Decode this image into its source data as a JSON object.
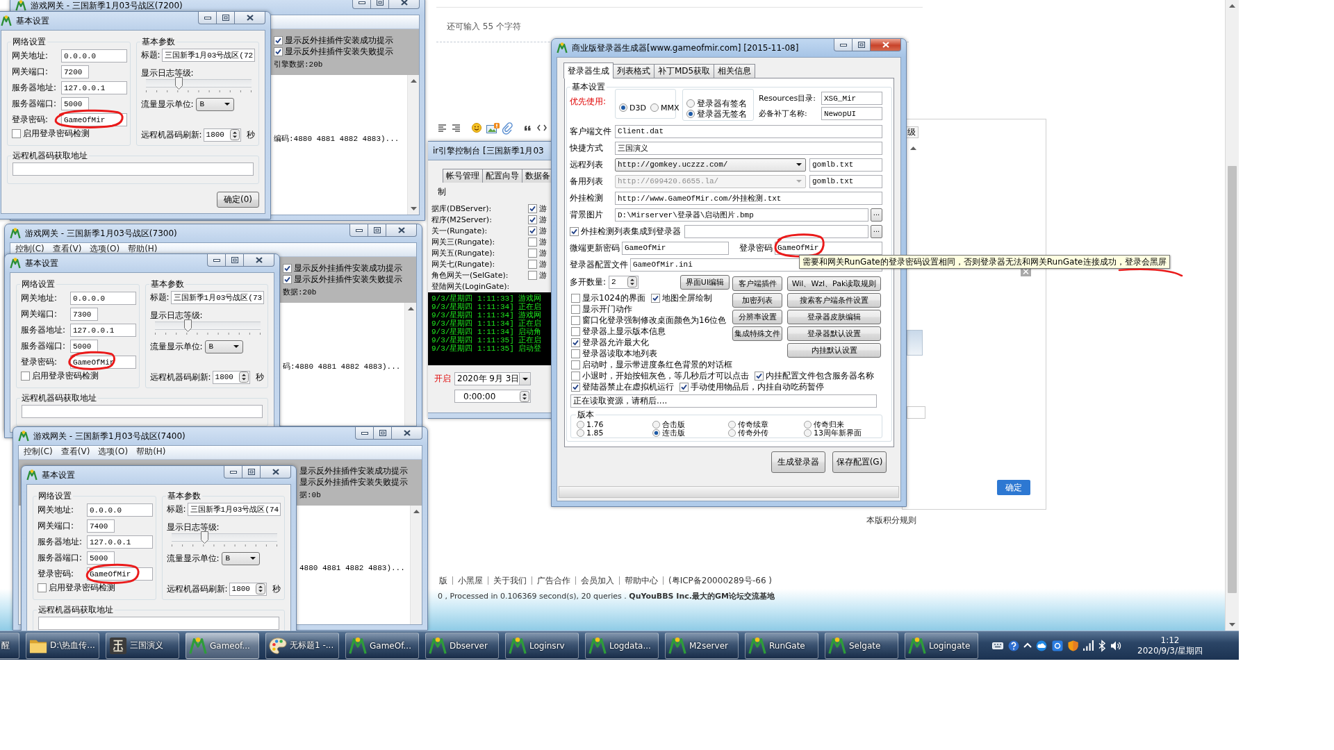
{
  "browser_page": {
    "char_hint": "还可输入 55 个字符",
    "side_panel": {
      "tab": "级",
      "ok_button": "确定"
    },
    "rules_link": "本版积分规则",
    "footer_links": [
      "版",
      "小黑屋",
      "关于我们",
      "广告合作",
      "会员加入",
      "帮助中心",
      "(粤ICP备20000289号-66 )"
    ],
    "footer_stats": "0 , Processed in 0.106369 second(s), 20 queries . **QuYouBBS Inc.最大的GM论坛交流基地**"
  },
  "console_window": {
    "title": "ir引擎控制台 [三国新季1月03",
    "tabs": [
      {
        "label": "帐号管理",
        "selected": false
      },
      {
        "label": "配置向导",
        "selected": false
      },
      {
        "label": "数据备",
        "selected": false
      }
    ],
    "group": "制",
    "services": [
      {
        "label": "据库(DBServer):",
        "checked": true,
        "option": "游"
      },
      {
        "label": "程序(M2Server):",
        "checked": true,
        "option": "游"
      },
      {
        "label": "关一(Rungate):",
        "checked": true,
        "option": "游"
      },
      {
        "label": "网关三(Rungate):",
        "checked": false,
        "option": "游"
      },
      {
        "label": "网关五(Rungate):",
        "checked": false,
        "option": "游"
      },
      {
        "label": "网关七(Rungate):",
        "checked": false,
        "option": "游"
      },
      {
        "label": "角色网关一(SelGate):",
        "checked": false,
        "option": "游"
      },
      {
        "label": "登陆网关(LoginGate):"
      }
    ],
    "log": [
      "9/3/星期四 1:11:33] 游戏网",
      "9/3/星期四 1:11:34] 正在启",
      "9/3/星期四 1:11:34] 游戏网",
      "9/3/星期四 1:11:34] 正在启",
      "9/3/星期四 1:11:34] 启动角",
      "9/3/星期四 1:11:35] 正在启",
      "9/3/星期四 1:11:35] 启动登"
    ],
    "schedule_label": "开启",
    "date": "2020年 9月 3日",
    "time": "0:00:00"
  },
  "gateway_windows": [
    {
      "title": "游戏网关 - 三国新季1月03号战区(7200)",
      "notices": [
        {
          "label": "显示反外挂插件安装成功提示",
          "checked": true
        },
        {
          "label": "显示反外挂插件安装失败提示",
          "checked": true
        }
      ],
      "data_label": "引擎数据:20b",
      "log_line": "编码:4880 4881 4882 4883)...",
      "dialog": {
        "title": "基本设置",
        "network_group": "网络设置",
        "fields": [
          {
            "label": "网关地址:",
            "value": "0.0.0.0",
            "kind": "wide"
          },
          {
            "label": "网关端口:",
            "value": "7200",
            "kind": "short"
          },
          {
            "label": "服务器地址:",
            "value": "127.0.0.1",
            "kind": "wide"
          },
          {
            "label": "服务器端口:",
            "value": "5000",
            "kind": "short"
          },
          {
            "label": "登录密码:",
            "value": "GameOfMir",
            "kind": "wide",
            "circled": true
          }
        ],
        "password_check": {
          "label": "启用登录密码检测",
          "checked": false
        },
        "params_group": "基本参数",
        "caption_label": "标题:",
        "caption": "三国新季1月03号战区(72",
        "log_level_label": "显示日志等级:",
        "log_level": {
          "level": 0.3
        },
        "unit_label": "流量显示单位:",
        "unit": "B",
        "refresh_label": "远程机器码刷新:",
        "refresh": "1800",
        "refresh_unit": "秒",
        "remote_group": "远程机器码获取地址",
        "ok_button": "确定(0)"
      }
    },
    {
      "title": "游戏网关 - 三国新季1月03号战区(7300)",
      "menu": [
        "控制(C)",
        "查看(V)",
        "选项(O)",
        "帮助(H)"
      ],
      "notices": [
        {
          "label": "显示反外挂插件安装成功提示",
          "checked": true
        },
        {
          "label": "显示反外挂插件安装失败提示",
          "checked": true
        }
      ],
      "data_label": "数据:20b",
      "log_line": "码:4880 4881 4882 4883)...",
      "dialog": {
        "title": "基本设置",
        "network_group": "网络设置",
        "fields": [
          {
            "label": "网关地址:",
            "value": "0.0.0.0",
            "kind": "wide"
          },
          {
            "label": "网关端口:",
            "value": "7300",
            "kind": "short"
          },
          {
            "label": "服务器地址:",
            "value": "127.0.0.1",
            "kind": "wide"
          },
          {
            "label": "服务器端口:",
            "value": "5000",
            "kind": "short"
          },
          {
            "label": "登录密码:",
            "value": "GameOfMir",
            "kind": "wide",
            "circled": true
          }
        ],
        "password_check": {
          "label": "启用登录密码检测",
          "checked": false
        },
        "params_group": "基本参数",
        "caption_label": "标题:",
        "caption": "三国新季1月03号战区(73",
        "log_level_label": "显示日志等级:",
        "log_level": {
          "level": 0.3
        },
        "unit_label": "流量显示单位:",
        "unit": "B",
        "refresh_label": "远程机器码刷新:",
        "refresh": "1800",
        "refresh_unit": "秒",
        "remote_group": "远程机器码获取地址"
      }
    },
    {
      "title": "游戏网关 - 三国新季1月03号战区(7400)",
      "menu": [
        "控制(C)",
        "查看(V)",
        "选项(O)",
        "帮助(H)"
      ],
      "notices": [
        {
          "label": "显示反外挂插件安装成功提示"
        },
        {
          "label": "显示反外挂插件安装失败提示"
        }
      ],
      "data_label": "据:0b",
      "log_line": "4880 4881 4882 4883)...",
      "dialog": {
        "title": "基本设置",
        "network_group": "网络设置",
        "fields": [
          {
            "label": "网关地址:",
            "value": "0.0.0.0",
            "kind": "wide"
          },
          {
            "label": "网关端口:",
            "value": "7400",
            "kind": "short"
          },
          {
            "label": "服务器地址:",
            "value": "127.0.0.1",
            "kind": "wide"
          },
          {
            "label": "服务器端口:",
            "value": "5000",
            "kind": "short"
          },
          {
            "label": "登录密码:",
            "value": "GameOfMir",
            "kind": "wide",
            "circled": true
          }
        ],
        "password_check": {
          "label": "启用登录密码检测",
          "checked": false
        },
        "params_group": "基本参数",
        "caption_label": "标题:",
        "caption": "三国新季1月03号战区(74",
        "log_level_label": "显示日志等级:",
        "log_level": {
          "level": 0.3
        },
        "unit_label": "流量显示单位:",
        "unit": "B",
        "refresh_label": "远程机器码刷新:",
        "refresh": "1800",
        "refresh_unit": "秒",
        "remote_group": "远程机器码获取地址"
      }
    }
  ],
  "generator_window": {
    "title": "商业版登录器生成器[www.gameofmir.com] [2015-11-08]",
    "tabs": [
      {
        "label": "登录器生成",
        "selected": true
      },
      {
        "label": "列表格式",
        "selected": false
      },
      {
        "label": "补丁MD5获取",
        "selected": false
      },
      {
        "label": "相关信息",
        "selected": false
      }
    ],
    "group": "基本设置",
    "priority_label": "优先使用:",
    "render_modes": [
      {
        "label": "D3D",
        "selected": true
      },
      {
        "label": "MMX",
        "selected": false
      }
    ],
    "signatures": [
      {
        "label": "登录器有签名",
        "selected": false
      },
      {
        "label": "登录器无签名",
        "selected": true
      }
    ],
    "resources_label": "Resources目录:",
    "resources": "XSG_Mir",
    "patch_label": "必备补丁名称:",
    "patch": "NewopUI",
    "rows": [
      {
        "kind": "text",
        "label": "客户端文件",
        "value": "Client.dat"
      },
      {
        "kind": "text",
        "label": "快捷方式",
        "value": "三国演义"
      },
      {
        "kind": "combo",
        "label": "远程列表",
        "value": "http://gomkey.uczzz.com/",
        "disabled": false,
        "file": "gomlb.txt"
      },
      {
        "kind": "combo",
        "label": "备用列表",
        "value": "http://699420.6655.la/",
        "disabled": true,
        "file": "gomlb.txt"
      },
      {
        "kind": "text",
        "label": "外挂检测",
        "value": "http://www.GameOfMir.com/外挂检测.txt"
      },
      {
        "kind": "browse",
        "label": "背景图片",
        "value": "D:\\Mirserver\\登录器\\启动图片.bmp",
        "button": "..."
      },
      {
        "kind": "check",
        "label": "外挂检测列表集成到登录器",
        "checked": true,
        "button": "..."
      },
      {
        "kind": "passwords",
        "label": "微端更新密码",
        "value": "GameOfMir",
        "label_2": "登录密码",
        "value_2": "GameOfMir",
        "circled": true
      },
      {
        "kind": "text",
        "label": "登录器配置文件",
        "value": "GameOfMir.ini"
      }
    ],
    "tooltip": {
      "text": "需要和网关RunGate的登录密码设置相同，否则登录器无法和网关RunGate连接成功，登录会黑屏",
      "underlined": true
    },
    "instances_label": "多开数量:",
    "instances": "2",
    "tool_buttons": [
      [
        "界面UI编辑"
      ],
      [
        "客户端插件",
        "加密列表",
        "分辨率设置",
        "集成特殊文件"
      ],
      [
        "Wil、Wzl、Pak读取规则",
        "搜索客户端条件设置",
        "登录器皮肤编辑",
        "登录器默认设置",
        "内挂默认设置"
      ]
    ],
    "options": [
      [
        {
          "label": "显示1024的界面",
          "checked": false
        },
        {
          "label": "地图全屏绘制",
          "checked": true
        }
      ],
      [
        {
          "label": "显示开门动作",
          "checked": false
        }
      ],
      [
        {
          "label": "窗口化登录强制修改桌面颜色为16位色",
          "checked": false
        }
      ],
      [
        {
          "label": "登录器上显示版本信息",
          "checked": false
        }
      ],
      [
        {
          "label": "登录器允许最大化",
          "checked": true
        }
      ],
      [
        {
          "label": "登录器读取本地列表",
          "checked": false
        }
      ],
      [
        {
          "label": "启动时，显示带进度条红色背景的对话框",
          "checked": false
        }
      ],
      [
        {
          "label": "小退时，开始按钮灰色，等几秒后才可以点击",
          "checked": false
        },
        {
          "label": "内挂配置文件包含服务器名称",
          "checked": true
        }
      ],
      [
        {
          "label": "登陆器禁止在虚拟机运行",
          "checked": true
        },
        {
          "label": "手动使用物品后，内挂自动吃药暂停",
          "checked": true
        }
      ]
    ],
    "status": "正在读取资源，请稍后....",
    "version_group": "版本",
    "versions": [
      {
        "label": "1.76",
        "selected": false
      },
      {
        "label": "1.85",
        "selected": false
      },
      {
        "label": "合击版",
        "selected": false
      },
      {
        "label": "连击版",
        "selected": true
      },
      {
        "label": "传奇续章",
        "selected": false
      },
      {
        "label": "传奇外传",
        "selected": false
      },
      {
        "label": "传奇归来",
        "selected": false
      },
      {
        "label": "13周年新界面",
        "selected": false
      }
    ],
    "generate_button": "生成登录器",
    "save_button": "保存配置(G)"
  },
  "taskbar": {
    "items": [
      {
        "label": "醒",
        "kind": "partial",
        "selected": false
      },
      {
        "label": "D:\\热血传...",
        "kind": "folder",
        "selected": false
      },
      {
        "label": "三国演义",
        "kind": "emblem",
        "selected": false
      },
      {
        "label": "Gameof...",
        "kind": "app",
        "selected": true
      },
      {
        "label": "无标题1 -...",
        "kind": "paint",
        "selected": false
      },
      {
        "label": "GameOf...",
        "kind": "app",
        "selected": false
      },
      {
        "label": "Dbserver",
        "kind": "app",
        "selected": false
      },
      {
        "label": "Loginsrv",
        "kind": "app",
        "selected": false
      },
      {
        "label": "Logdata...",
        "kind": "app",
        "selected": false
      },
      {
        "label": "M2server",
        "kind": "app",
        "selected": false
      },
      {
        "label": "RunGate",
        "kind": "app",
        "selected": false
      },
      {
        "label": "Selgate",
        "kind": "app",
        "selected": false
      },
      {
        "label": "Logingate",
        "kind": "app",
        "selected": false
      }
    ],
    "clock": {
      "time": "1:12",
      "date": "2020/9/3/星期四"
    }
  }
}
